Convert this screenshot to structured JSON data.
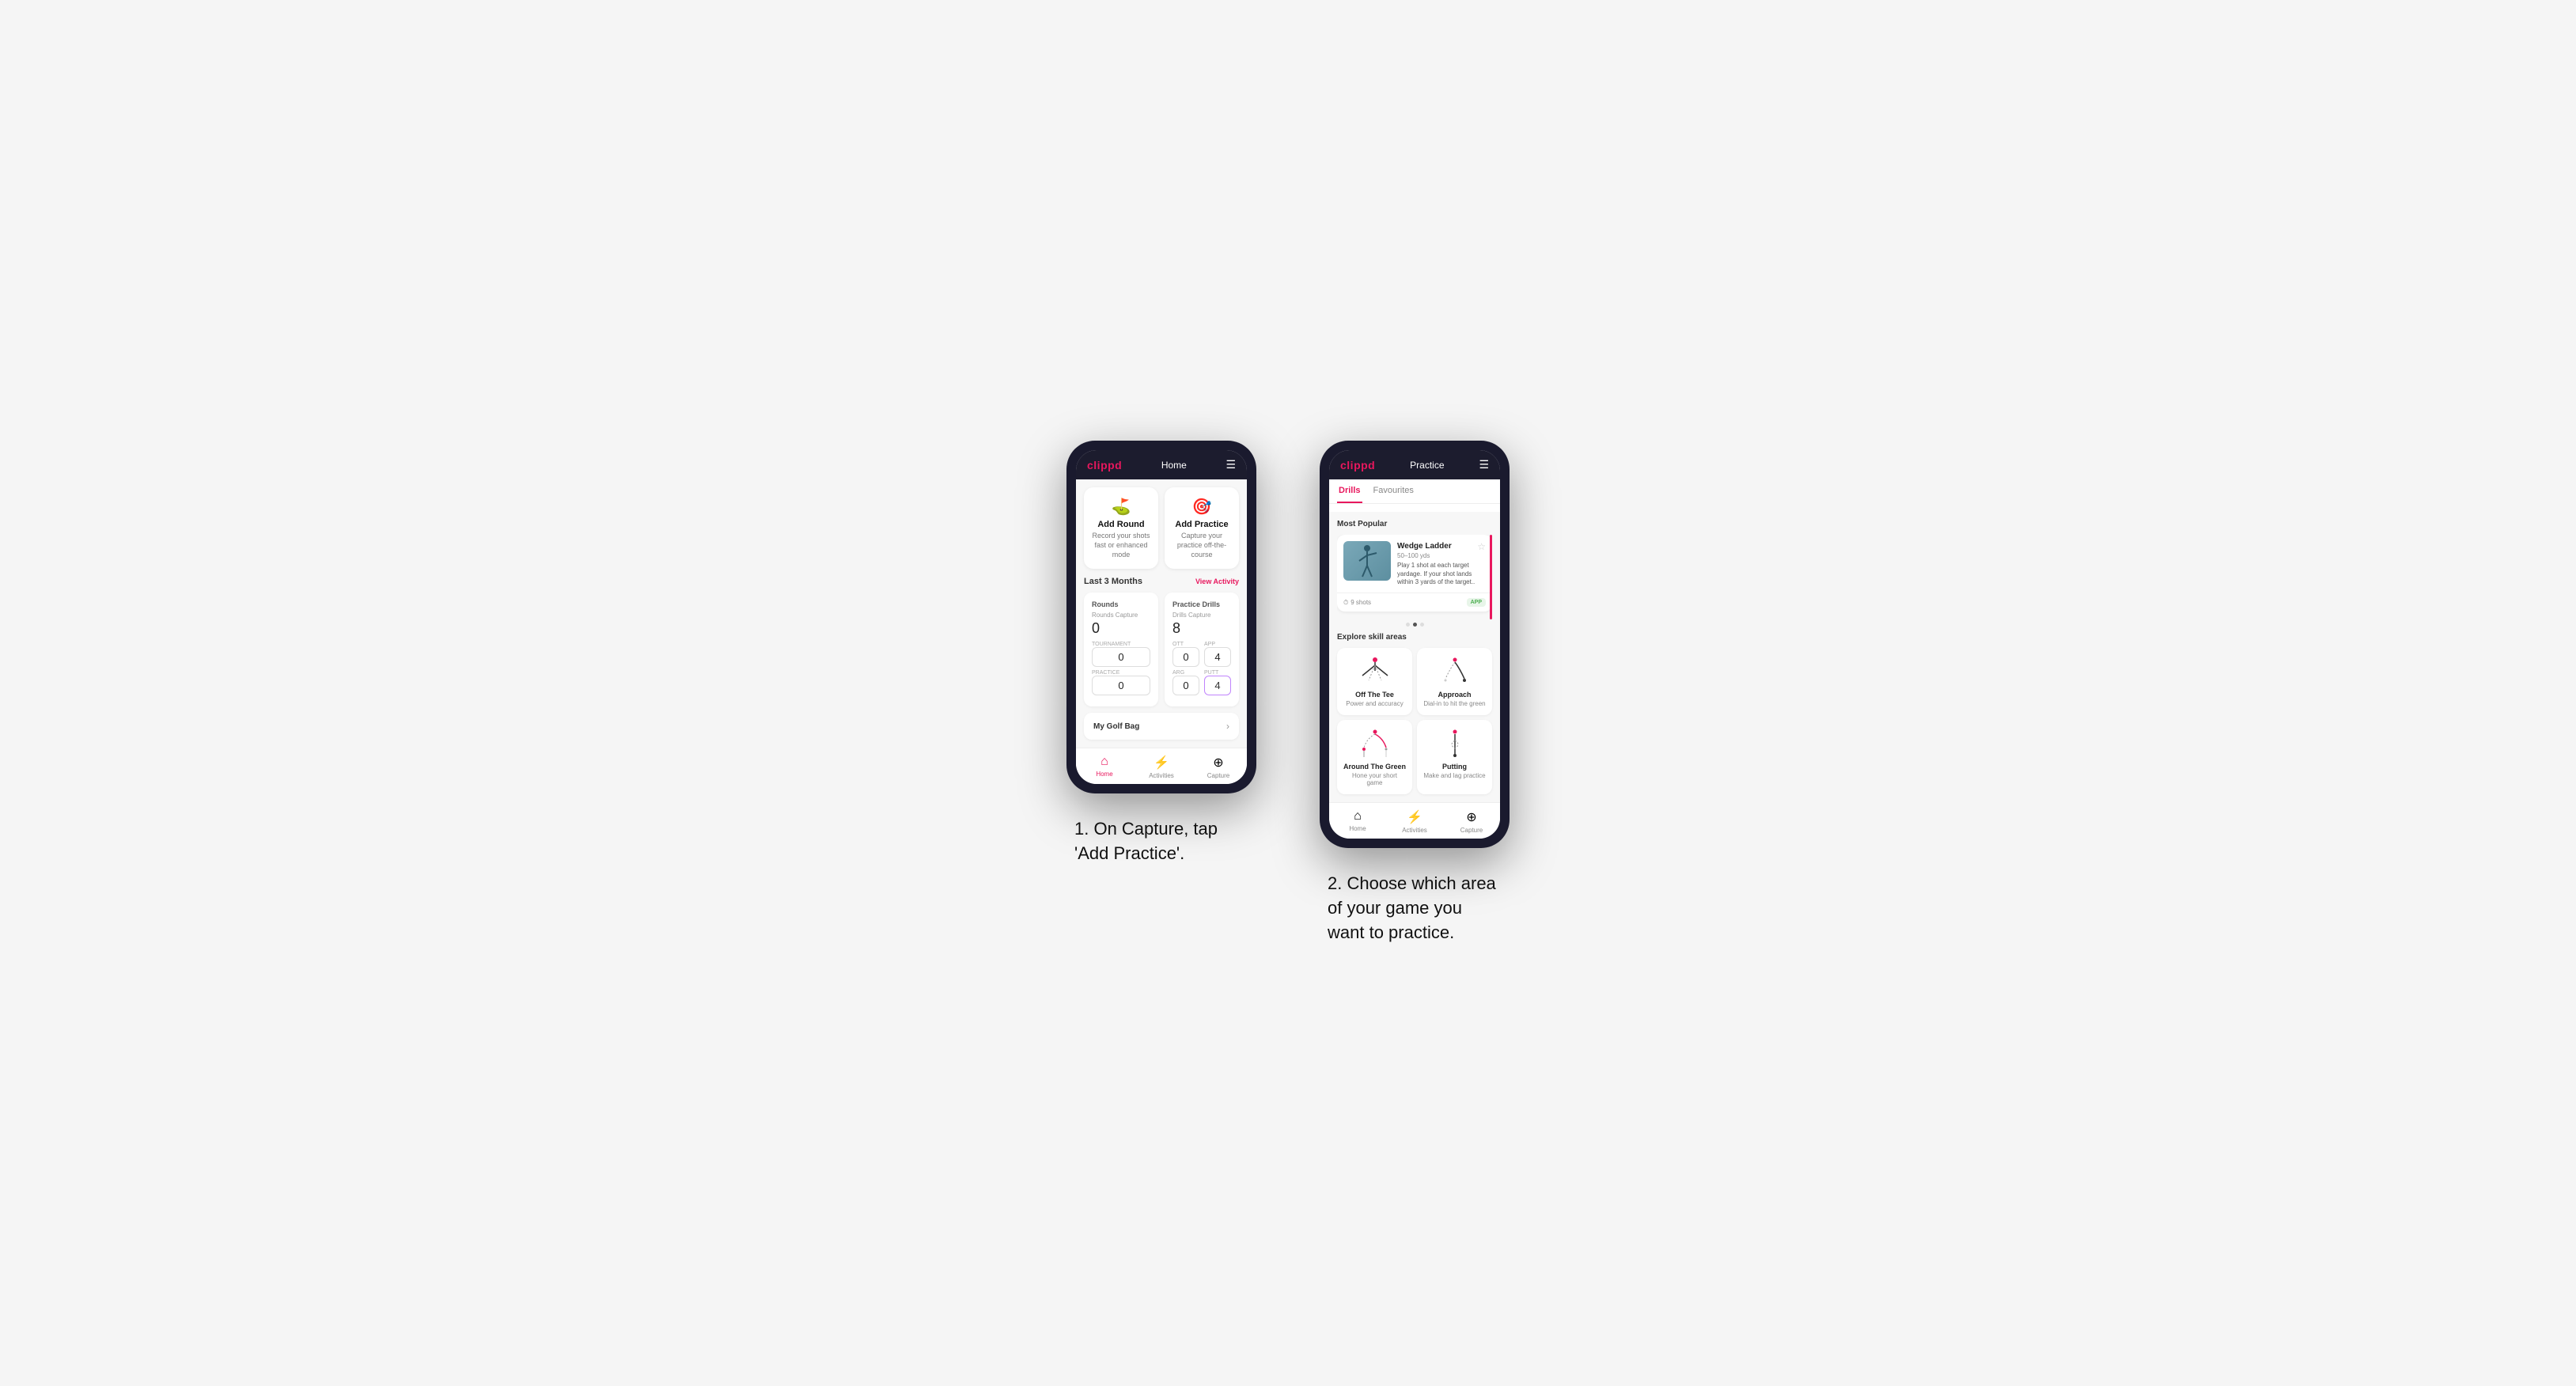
{
  "page": {
    "background": "#f5f5f5"
  },
  "phone1": {
    "header": {
      "logo": "clippd",
      "title": "Home",
      "menu_icon": "☰"
    },
    "action_cards": [
      {
        "id": "add-round",
        "icon": "⛳",
        "title": "Add Round",
        "subtitle": "Record your shots fast or enhanced mode"
      },
      {
        "id": "add-practice",
        "icon": "🎯",
        "title": "Add Practice",
        "subtitle": "Capture your practice off-the-course"
      }
    ],
    "activity_section": {
      "title": "Last 3 Months",
      "link": "View Activity"
    },
    "rounds": {
      "title": "Rounds",
      "capture_label": "Rounds Capture",
      "value": "0",
      "sub_stats": [
        {
          "label": "Tournament",
          "value": "0"
        },
        {
          "label": "Practice",
          "value": "0"
        }
      ]
    },
    "practice_drills": {
      "title": "Practice Drills",
      "capture_label": "Drills Capture",
      "value": "8",
      "sub_stats": [
        {
          "label": "OTT",
          "value": "0"
        },
        {
          "label": "APP",
          "value": "4",
          "highlight": false
        },
        {
          "label": "ARG",
          "value": "0"
        },
        {
          "label": "PUTT",
          "value": "4",
          "highlight": true
        }
      ]
    },
    "golf_bag": {
      "label": "My Golf Bag"
    },
    "nav": [
      {
        "icon": "🏠",
        "label": "Home",
        "active": true
      },
      {
        "icon": "⚡",
        "label": "Activities",
        "active": false
      },
      {
        "icon": "➕",
        "label": "Capture",
        "active": false
      }
    ]
  },
  "phone2": {
    "header": {
      "logo": "clippd",
      "title": "Practice",
      "menu_icon": "☰"
    },
    "tabs": [
      {
        "label": "Drills",
        "active": true
      },
      {
        "label": "Favourites",
        "active": false
      }
    ],
    "most_popular": {
      "label": "Most Popular",
      "card": {
        "title": "Wedge Ladder",
        "range": "50–100 yds",
        "description": "Play 1 shot at each target yardage. If your shot lands within 3 yards of the target..",
        "shots": "9 shots",
        "badge": "APP"
      },
      "dots": [
        false,
        true,
        false
      ]
    },
    "explore": {
      "label": "Explore skill areas",
      "skills": [
        {
          "id": "off-the-tee",
          "title": "Off The Tee",
          "subtitle": "Power and accuracy",
          "icon_type": "tee"
        },
        {
          "id": "approach",
          "title": "Approach",
          "subtitle": "Dial-in to hit the green",
          "icon_type": "approach"
        },
        {
          "id": "around-the-green",
          "title": "Around The Green",
          "subtitle": "Hone your short game",
          "icon_type": "atg"
        },
        {
          "id": "putting",
          "title": "Putting",
          "subtitle": "Make and lag practice",
          "icon_type": "putting"
        }
      ]
    },
    "nav": [
      {
        "icon": "🏠",
        "label": "Home",
        "active": false
      },
      {
        "icon": "⚡",
        "label": "Activities",
        "active": false
      },
      {
        "icon": "➕",
        "label": "Capture",
        "active": false
      }
    ]
  },
  "captions": {
    "phone1": "1. On Capture, tap 'Add Practice'.",
    "phone2": "2. Choose which area of your game you want to practice."
  }
}
